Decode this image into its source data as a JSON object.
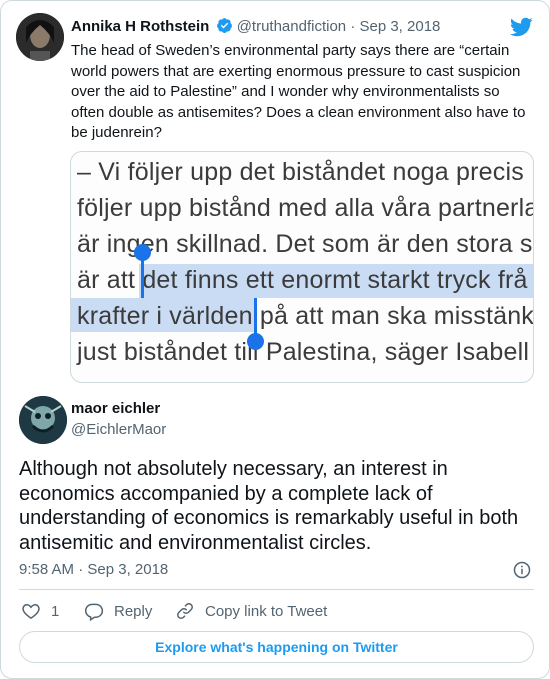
{
  "quoted_tweet": {
    "author_name": "Annika H Rothstein",
    "handle": "@truthandfiction",
    "separator": "·",
    "date": "Sep 3, 2018",
    "verified_icon": "verified-badge-icon",
    "text": "The head of Sweden’s environmental party says there are “certain world powers that are exerting enormous pressure to cast suspicion over the aid to Palestine” and I wonder why environmentalists so often double as antisemites? Does a clean environment also have to be judenrein?",
    "media": {
      "lines": [
        "– Vi följer upp det biståndet noga precis",
        "följer upp bistånd med alla våra partnerla",
        "är ingen skillnad. Det som är den stora s",
        "är att det finns ett enormt starkt tryck frå",
        "krafter i världen på att man ska misstänk",
        "just biståndet till Palestina, säger Isabell"
      ],
      "selection_color": "#c9dcf4",
      "handle_color": "#1a73e8"
    }
  },
  "brand": {
    "icon": "twitter-bird-icon",
    "color": "#1d9bf0"
  },
  "tweet": {
    "author_name": "maor eichler",
    "handle": "@EichlerMaor",
    "text": "Although not absolutely necessary, an interest in economics accompanied by a complete lack of understanding of economics is remarkably useful in both antisemitic and environmentalist circles.",
    "timestamp": "9:58 AM · Sep 3, 2018",
    "info_icon": "info-icon"
  },
  "actions": {
    "like": {
      "icon": "heart-icon",
      "count": "1"
    },
    "reply": {
      "icon": "reply-icon",
      "label": "Reply"
    },
    "copy_link": {
      "icon": "link-icon",
      "label": "Copy link to Tweet"
    }
  },
  "explore_button": {
    "label": "Explore what's happening on Twitter"
  }
}
